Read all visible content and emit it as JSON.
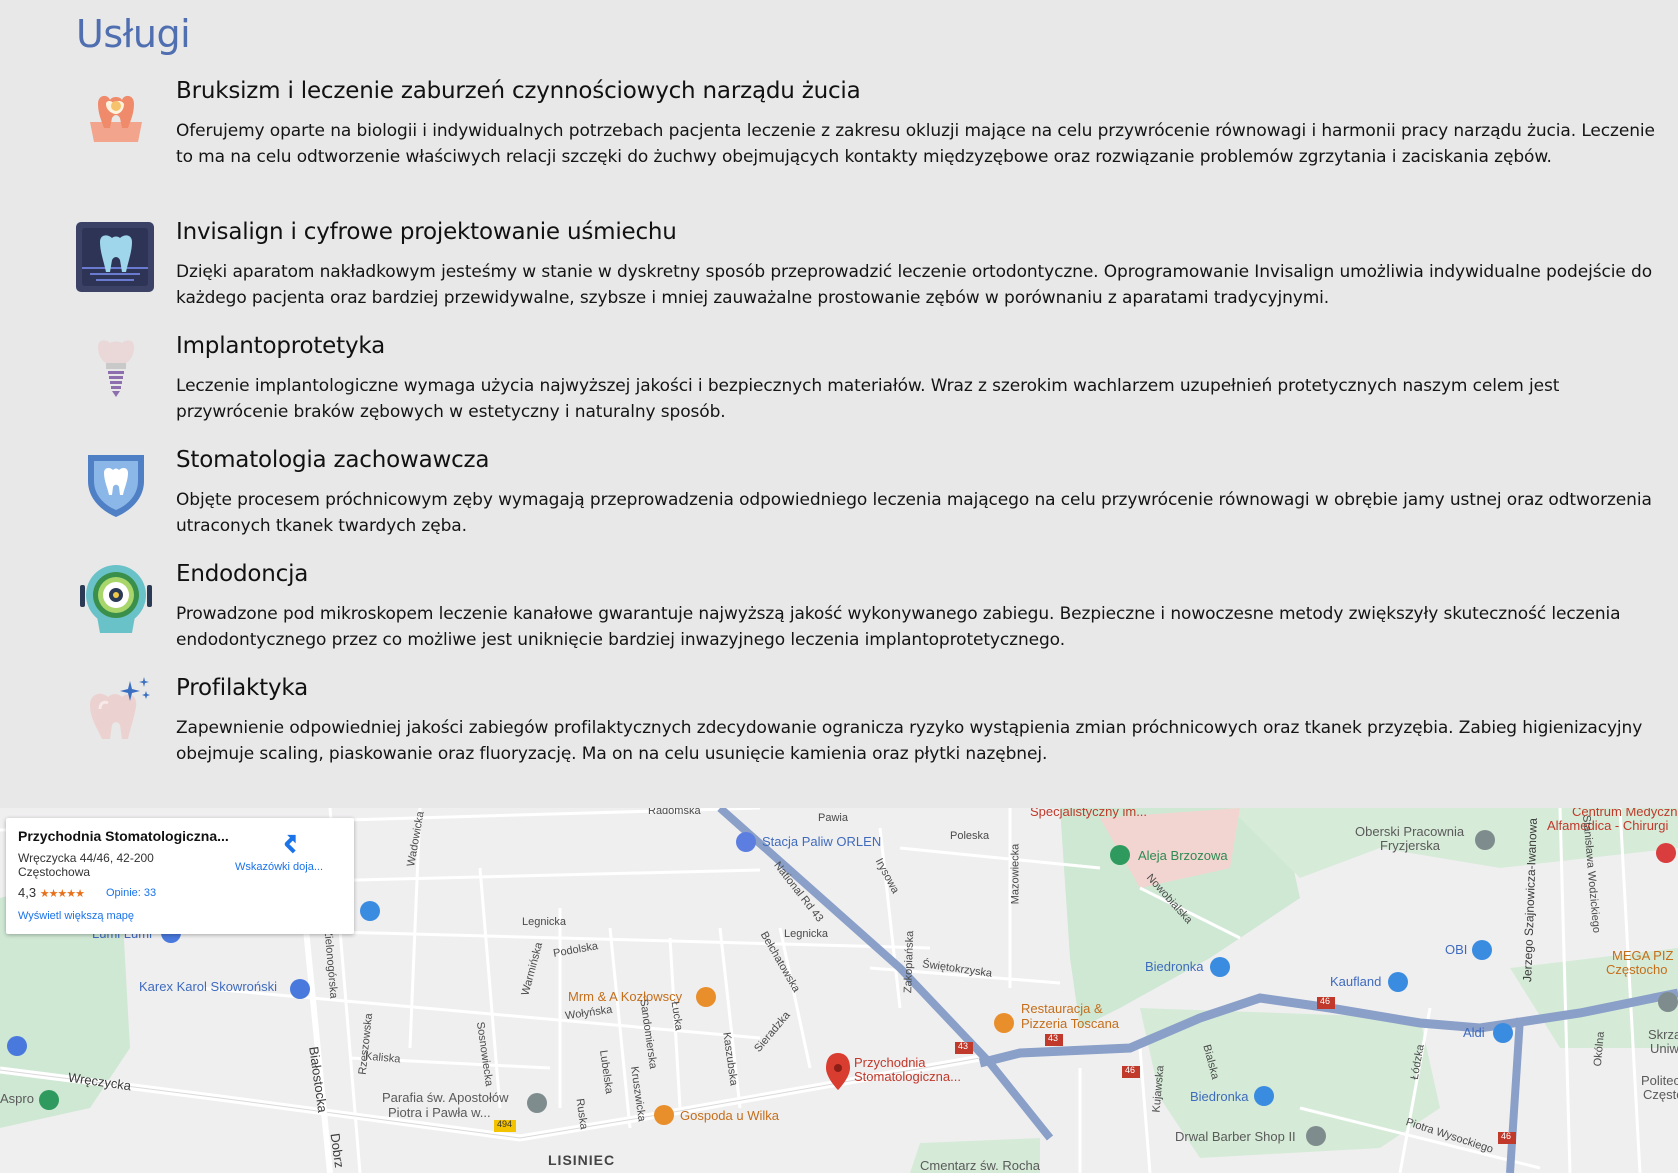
{
  "section_title": "Usługi",
  "services": [
    {
      "heading": "Bruksizm i leczenie zaburzeń czynnościowych narządu żucia",
      "description": "Oferujemy oparte na biologii i indywidualnych potrzebach pacjenta leczenie z zakresu okluzji mające na celu przywrócenie równowagi i harmonii pracy narządu żucia. Leczenie to ma na celu odtworzenie właściwych relacji szczęki do żuchwy obejmujących kontakty międzyzębowe oraz rozwiązanie problemów zgrzytania i zaciskania zębów.",
      "icon": "tooth-pain-icon"
    },
    {
      "heading": "Invisalign i cyfrowe projektowanie uśmiechu",
      "description": "Dzięki aparatom nakładkowym jesteśmy w stanie w dyskretny sposób przeprowadzić leczenie ortodontyczne. Oprogramowanie Invisalign umożliwia indywidualne podejście do każdego pacjenta oraz bardziej przewidywalne, szybsze i mniej zauważalne prostowanie zębów w porównaniu z aparatami tradycyjnymi.",
      "icon": "tooth-xray-icon"
    },
    {
      "heading": "Implantoprotetyka",
      "description": "Leczenie implantologiczne wymaga użycia najwyższej jakości i bezpiecznych materiałów. Wraz z szerokim wachlarzem uzupełnień protetycznych naszym celem jest przywrócenie braków zębowych w estetyczny i naturalny sposób.",
      "icon": "dental-implant-icon"
    },
    {
      "heading": "Stomatologia zachowawcza",
      "description": "Objęte procesem próchnicowym zęby wymagają przeprowadzenia odpowiedniego leczenia mającego na celu przywrócenie równowagi w obrębie jamy ustnej oraz odtworzenia utraconych tkanek twardych zęba.",
      "icon": "tooth-shield-icon"
    },
    {
      "heading": "Endodoncja",
      "description": "Prowadzone pod mikroskopem leczenie kanałowe gwarantuje najwyższą jakość wykonywanego zabiegu. Bezpieczne i nowoczesne metody zwiększyły skuteczność leczenia endodontycznego przez co możliwe jest uniknięcie bardziej inwazyjnego leczenia implantoprotetycznego.",
      "icon": "dental-lamp-icon"
    },
    {
      "heading": "Profilaktyka",
      "description": "Zapewnienie odpowiedniej jakości zabiegów profilaktycznych zdecydowanie ogranicza ryzyko wystąpienia zmian próchnicowych oraz tkanek przyzębia. Zabieg higienizacyjny obejmuje scaling, piaskowanie oraz fluoryzację. Ma on na celu usunięcie kamienia oraz płytki nazębnej.",
      "icon": "sparkling-tooth-icon"
    }
  ],
  "map": {
    "info_card": {
      "name": "Przychodnia Stomatologiczna...",
      "address": "Wręczycka 44/46, 42-200 Częstochowa",
      "rating": "4,3",
      "stars": "★★★★★",
      "reviews": "Opinie: 33",
      "larger_map": "Wyświetl większą mapę",
      "directions": "Wskazówki doja..."
    },
    "marker_label_1": "Przychodnia",
    "marker_label_2": "Stomatologiczna...",
    "labels": {
      "radomska": "Radomska",
      "pawia": "Pawia",
      "specjalistyczny": "Specjalistyczny im...",
      "centrum_medyczne_1": "Centrum Medyczne",
      "centrum_medyczne_2": "Alfamedica - Chirurgi",
      "poleska": "Poleska",
      "stacja_paliw": "Stacja Paliw ORLEN",
      "oberski_1": "Oberski Pracownia",
      "oberski_2": "Fryzjerska",
      "aleja_brzozowa": "Aleja Brzozowa",
      "irysowa": "Irysowa",
      "national_rd": "National Rd 43",
      "nowobialska": "Nowobialska",
      "mazowiecka": "Mazowiecka",
      "wadowicka": "Wadowicka",
      "lumi_lumi": "Lumi Lumi",
      "legnicka_1": "Legnicka",
      "legnicka_2": "Legnicka",
      "zielonogorska": "Zielonogórska",
      "podolska": "Podolska",
      "warminska": "Warmińska",
      "belchatowska": "Bełchatowska",
      "zakopianska": "Zakopiańska",
      "swietokrzyska": "Świętokrzyska",
      "biedronka_1": "Biedronka",
      "obi": "OBI",
      "kaufland": "Kaufland",
      "mega_pizza_1": "MEGA PIZ",
      "mega_pizza_2": "Częstocho",
      "karex": "Karex Karol Skowroński",
      "mrm": "Mrm & A Kozłowscy",
      "wolynska": "Wołyńska",
      "restauracja_1": "Restauracja &",
      "restauracja_2": "Pizzeria Toscana",
      "rzeszowska": "Rzeszowska",
      "sosnowiecka": "Sosnowiecka",
      "sandomierska": "Sandomierska",
      "lucka": "Łucka",
      "kaszubska": "Kaszubska",
      "sieradzka": "Sieradzka",
      "kaliska": "Kaliska",
      "lubelska": "Lubelska",
      "aldi": "Aldi",
      "skrzat_1": "Skrzat",
      "skrzat_2": "Uniwe",
      "bialostocka": "Białostocka",
      "wreczycka": "Wręczycka",
      "aspro": "Aspro",
      "parafia_1": "Parafia św. Apostołów",
      "parafia_2": "Piotra i Pawła w...",
      "gospoda": "Gospoda u Wilka",
      "kruszwicka": "Kruszwicka",
      "ruska": "Ruska",
      "kujawska": "Kujawska",
      "bialska": "Bialska",
      "lodzka": "Łódzka",
      "biedronka_2": "Biedronka",
      "politechnika_1": "Politec",
      "politechnika_2": "Często",
      "drwal": "Drwal Barber Shop II",
      "piotra_wysockiego": "Piotra Wysockiego",
      "lisiniec": "LISINIEC",
      "dobrzynska": "Dobrz",
      "cmentarz": "Cmentarz św. Rocha",
      "stanislawa_wodzickiego": "Stanisława Wodzickiego",
      "jerzego": "Jerzego Szajnowicza-Iwanowa",
      "okolna": "Okólna",
      "road_43_a": "43",
      "road_43_b": "43",
      "road_46_a": "46",
      "road_46_b": "46",
      "road_46_c": "46",
      "road_494": "494"
    }
  }
}
